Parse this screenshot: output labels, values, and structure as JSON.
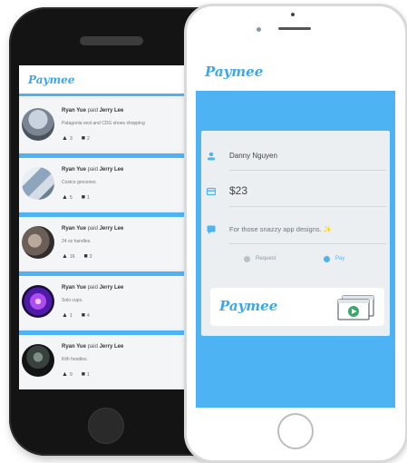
{
  "feed_app": {
    "brand": "Paymee",
    "items": [
      {
        "payer": "Ryan Yue",
        "verb": "paid",
        "payee": "Jerry Lee",
        "note": "Patagonia vest and CDG shoes shopping",
        "likes": "3",
        "comments": "2"
      },
      {
        "payer": "Ryan Yue",
        "verb": "paid",
        "payee": "Jerry Lee",
        "note": "Costco groceries.",
        "likes": "5",
        "comments": "1"
      },
      {
        "payer": "Ryan Yue",
        "verb": "paid",
        "payee": "Jerry Lee",
        "note": "24 oz handles.",
        "likes": "16",
        "comments": "2"
      },
      {
        "payer": "Ryan Yue",
        "verb": "paid",
        "payee": "Jerry Lee",
        "note": "Solo cups.",
        "likes": "1",
        "comments": "4"
      },
      {
        "payer": "Ryan Yue",
        "verb": "paid",
        "payee": "Jerry Lee",
        "note": "Kith hoodies.",
        "likes": "9",
        "comments": "1"
      }
    ]
  },
  "pay_app": {
    "brand": "Paymee",
    "recipient": "Danny Nguyen",
    "amount": "$23",
    "memo": "For those snazzy app designs. ✨",
    "toggle": {
      "request_label": "Request",
      "pay_label": "Pay",
      "selected": "Pay"
    },
    "footer_brand": "Paymee"
  },
  "icons": {
    "person": "person-icon",
    "card": "card-icon",
    "message": "message-icon",
    "like": "thumbs-up-icon",
    "comment": "comment-icon",
    "video": "video-play-icon"
  },
  "colors": {
    "accent": "#4eb3f2",
    "brand_text": "#3aa8ee",
    "phone_dark": "#141414",
    "card_bg": "#eceff2"
  }
}
